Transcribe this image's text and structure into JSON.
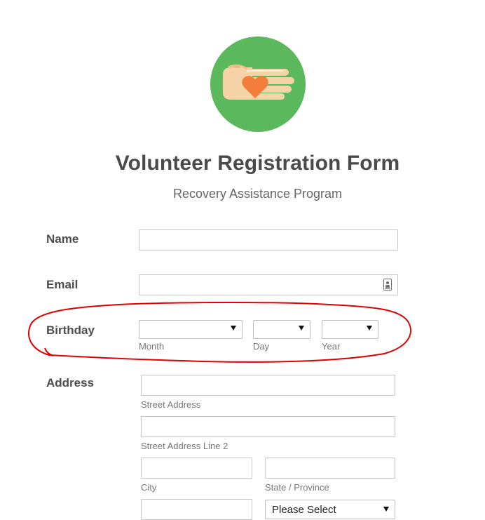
{
  "form": {
    "title": "Volunteer Registration Form",
    "subtitle": "Recovery Assistance Program"
  },
  "fields": {
    "name": {
      "label": "Name",
      "value": ""
    },
    "email": {
      "label": "Email",
      "value": "",
      "icon": "contact-card-icon"
    },
    "birthday": {
      "label": "Birthday",
      "month": {
        "sublabel": "Month",
        "selected": ""
      },
      "day": {
        "sublabel": "Day",
        "selected": ""
      },
      "year": {
        "sublabel": "Year",
        "selected": ""
      }
    },
    "address": {
      "label": "Address",
      "street": {
        "sublabel": "Street Address",
        "value": ""
      },
      "street2": {
        "sublabel": "Street Address Line 2",
        "value": ""
      },
      "city": {
        "sublabel": "City",
        "value": ""
      },
      "state": {
        "sublabel": "State / Province",
        "value": ""
      },
      "postal": {
        "value": ""
      },
      "country": {
        "selected": "Please Select"
      }
    }
  },
  "colors": {
    "logo_circle": "#5cb85c",
    "hand": "#f5d3a6",
    "heart": "#f47d3a",
    "annotation": "#e00000"
  }
}
